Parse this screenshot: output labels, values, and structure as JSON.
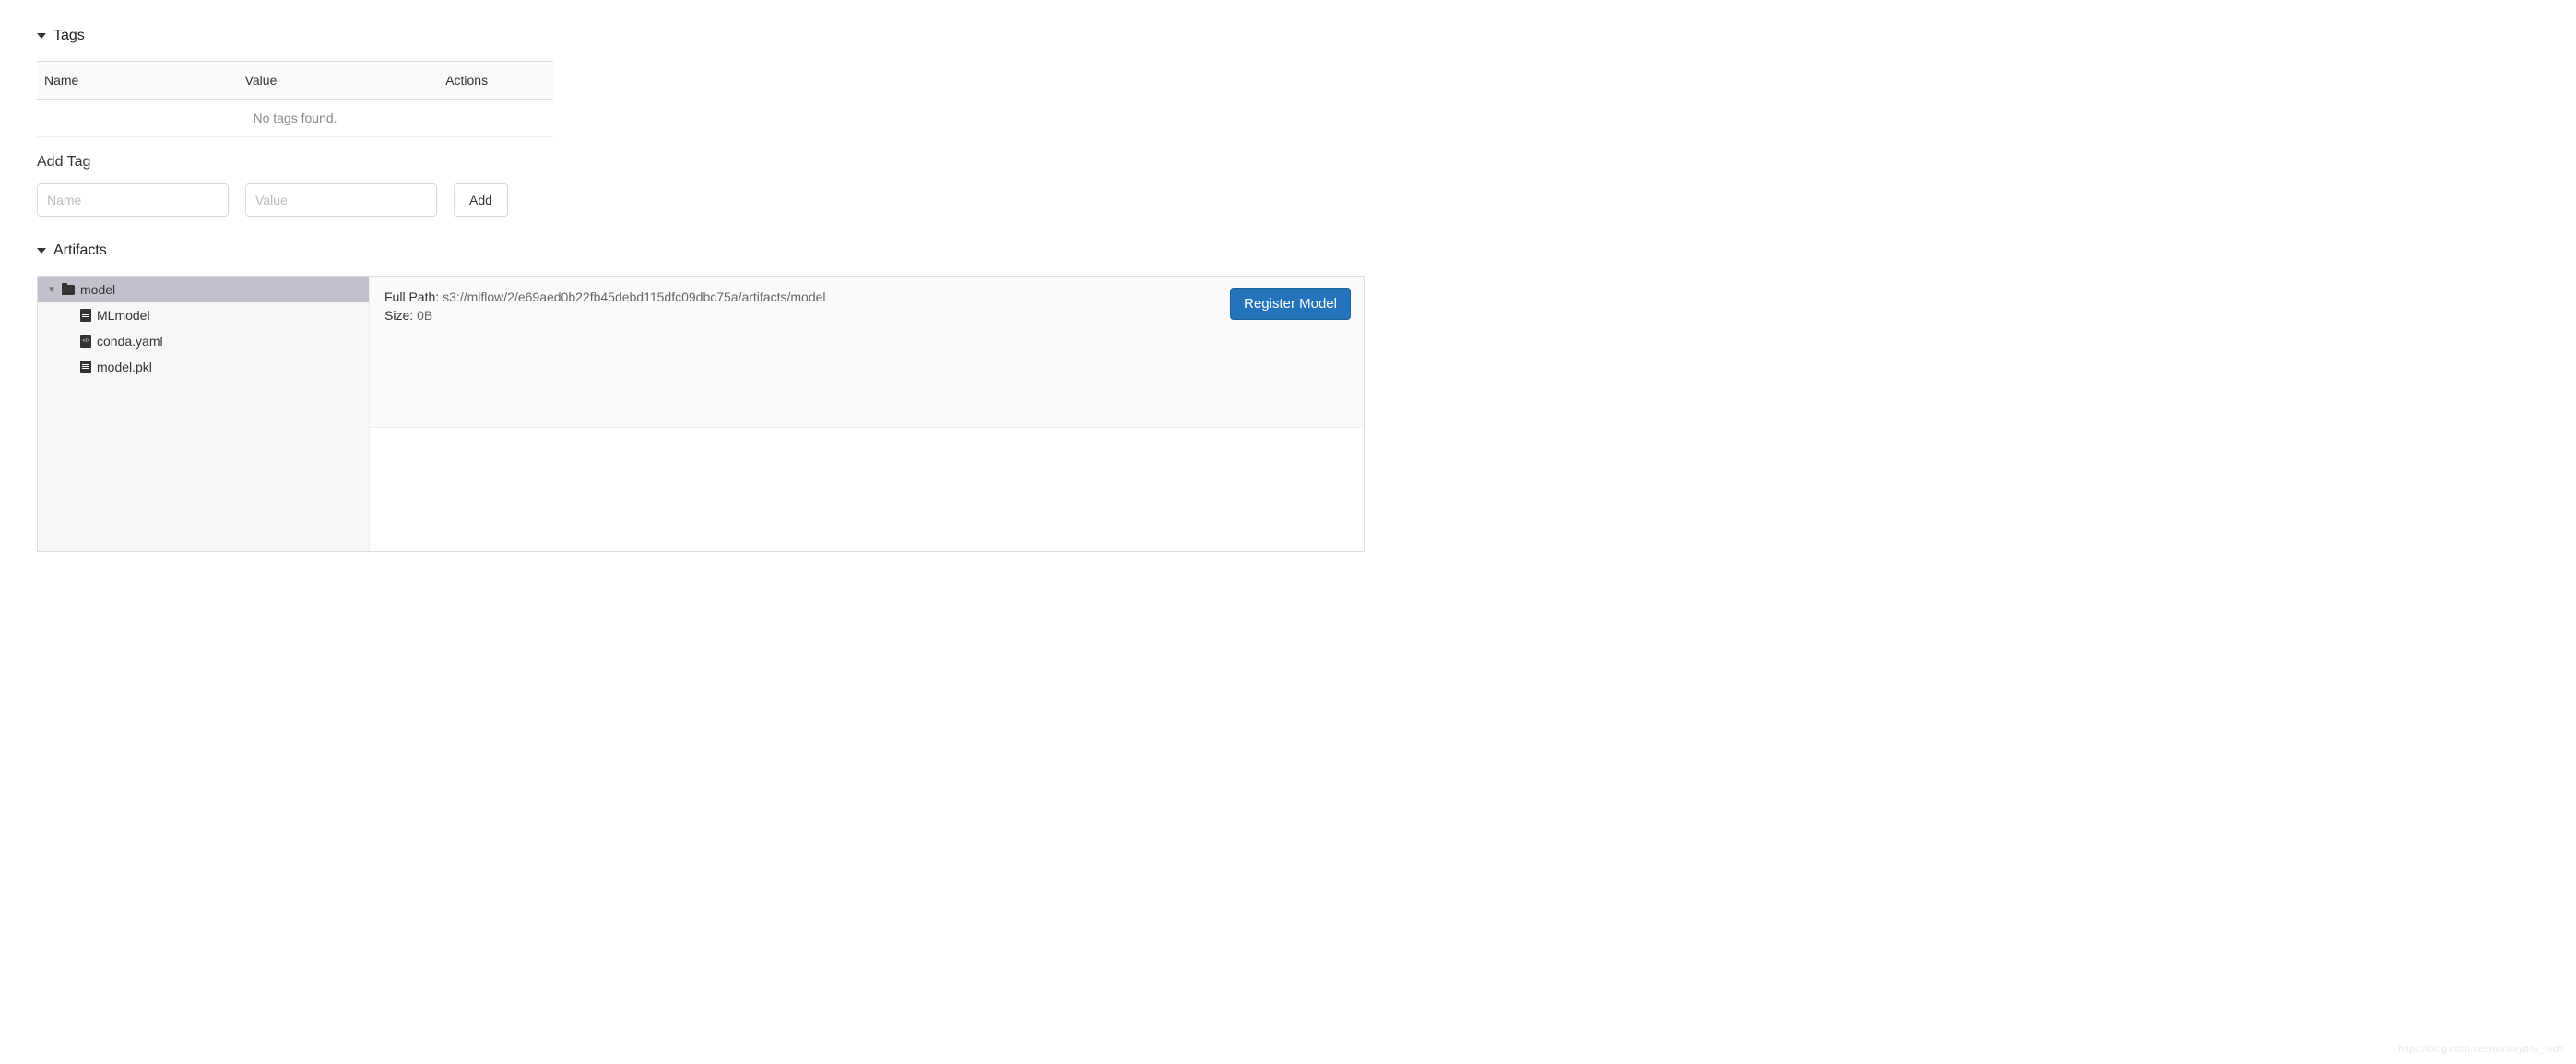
{
  "tags": {
    "title": "Tags",
    "columns": {
      "name": "Name",
      "value": "Value",
      "actions": "Actions"
    },
    "empty": "No tags found.",
    "addTitle": "Add Tag",
    "namePlaceholder": "Name",
    "valuePlaceholder": "Value",
    "addButton": "Add"
  },
  "artifacts": {
    "title": "Artifacts",
    "tree": {
      "root": "model",
      "children": [
        {
          "name": "MLmodel",
          "iconType": "file"
        },
        {
          "name": "conda.yaml",
          "iconType": "code"
        },
        {
          "name": "model.pkl",
          "iconType": "file"
        }
      ]
    },
    "detail": {
      "fullPathLabel": "Full Path:",
      "fullPathValue": "s3://mlflow/2/e69aed0b22fb45debd115dfc09dbc75a/artifacts/model",
      "sizeLabel": "Size:",
      "sizeValue": "0B"
    },
    "registerButton": "Register Model"
  },
  "watermark": "https://blog.csdn.net/monkeyboy_tech"
}
